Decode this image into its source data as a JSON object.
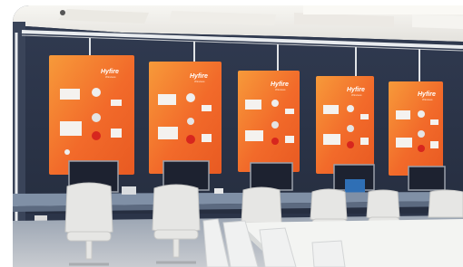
{
  "photo": {
    "panel_brand": "Hyfire",
    "panel_sub": "Wireless",
    "colors": {
      "wall": "#2b3448",
      "ceiling": "#f2f0ec",
      "panel_orange": "#f26a2a",
      "panel_orange_light": "#f79a3a",
      "desk": "#8090a6",
      "chair": "#e6e6e4",
      "table": "#f3f4f2"
    },
    "panels": [
      {
        "brand": "Hyfire",
        "sub": "Wireless"
      },
      {
        "brand": "Hyfire",
        "sub": "Wireless"
      },
      {
        "brand": "Hyfire",
        "sub": "Wireless"
      },
      {
        "brand": "Hyfire",
        "sub": "Wireless"
      },
      {
        "brand": "Hyfire",
        "sub": "Wireless"
      }
    ]
  }
}
